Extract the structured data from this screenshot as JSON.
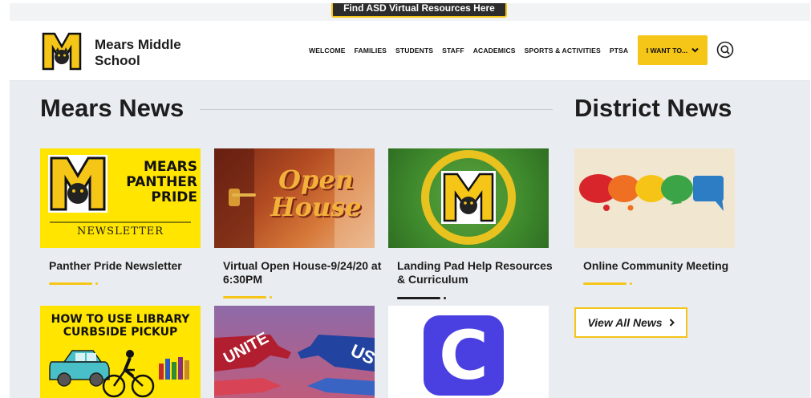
{
  "banner": {
    "label": "Find ASD Virtual Resources Here"
  },
  "header": {
    "school_name": "Mears Middle School",
    "nav": [
      "WELCOME",
      "FAMILIES",
      "STUDENTS",
      "STAFF",
      "ACADEMICS",
      "SPORTS & ACTIVITIES",
      "PTSA"
    ],
    "want_label": "I WANT TO...",
    "search_icon": "search-icon"
  },
  "mears_news": {
    "title": "Mears News",
    "cards": [
      {
        "title": "Panther Pride Newsletter",
        "image_text": [
          "MEARS",
          "PANTHER",
          "PRIDE"
        ],
        "image_caption": "NEWSLETTER"
      },
      {
        "title": "Virtual Open House-9/24/20 at 6:30PM",
        "image_text": [
          "Open",
          "House"
        ]
      },
      {
        "title": "Landing Pad Help Resources & Curriculum"
      },
      {
        "title": "",
        "image_text": [
          "HOW TO USE LIBRARY",
          "CURBSIDE PICKUP"
        ]
      },
      {
        "title": "",
        "image_text": [
          "UNITE",
          "US"
        ]
      },
      {
        "title": "",
        "image_text": [
          "C"
        ]
      }
    ]
  },
  "district_news": {
    "title": "District News",
    "cards": [
      {
        "title": "Online Community Meeting"
      }
    ],
    "view_all_label": "View All News"
  },
  "colors": {
    "accent": "#f5c518",
    "dark": "#1d1d1d",
    "background": "#e9ecf0"
  }
}
